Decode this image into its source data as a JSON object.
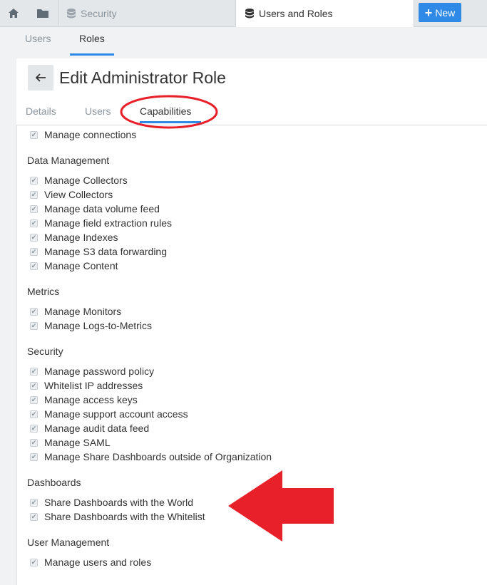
{
  "topbar": {
    "home_icon": "home-icon",
    "folder_icon": "folder-icon",
    "tabs": [
      {
        "label": "Security",
        "icon": "database-icon",
        "active": false
      },
      {
        "label": "Users and Roles",
        "icon": "database-icon",
        "active": true
      }
    ],
    "new_button": {
      "label": "New",
      "icon": "plus-icon"
    }
  },
  "subtabs": [
    {
      "label": "Users",
      "active": false
    },
    {
      "label": "Roles",
      "active": true
    }
  ],
  "page": {
    "title": "Edit Administrator Role",
    "back_icon": "arrow-left-icon",
    "tabs": [
      {
        "label": "Details",
        "active": false
      },
      {
        "label": "Users",
        "active": false
      },
      {
        "label": "Capabilities",
        "active": true
      }
    ]
  },
  "capabilities": {
    "top_items": [
      "Manage connections"
    ],
    "sections": [
      {
        "title": "Data Management",
        "items": [
          "Manage Collectors",
          "View Collectors",
          "Manage data volume feed",
          "Manage field extraction rules",
          "Manage Indexes",
          "Manage S3 data forwarding",
          "Manage Content"
        ]
      },
      {
        "title": "Metrics",
        "items": [
          "Manage Monitors",
          "Manage Logs-to-Metrics"
        ]
      },
      {
        "title": "Security",
        "items": [
          "Manage password policy",
          "Whitelist IP addresses",
          "Manage access keys",
          "Manage support account access",
          "Manage audit data feed",
          "Manage SAML",
          "Manage Share Dashboards outside of Organization"
        ]
      },
      {
        "title": "Dashboards",
        "items": [
          "Share Dashboards with the World",
          "Share Dashboards with the Whitelist"
        ]
      },
      {
        "title": "User Management",
        "items": [
          "Manage users and roles"
        ]
      }
    ]
  },
  "colors": {
    "accent": "#2e8ae6",
    "annotation": "#e8202a"
  }
}
